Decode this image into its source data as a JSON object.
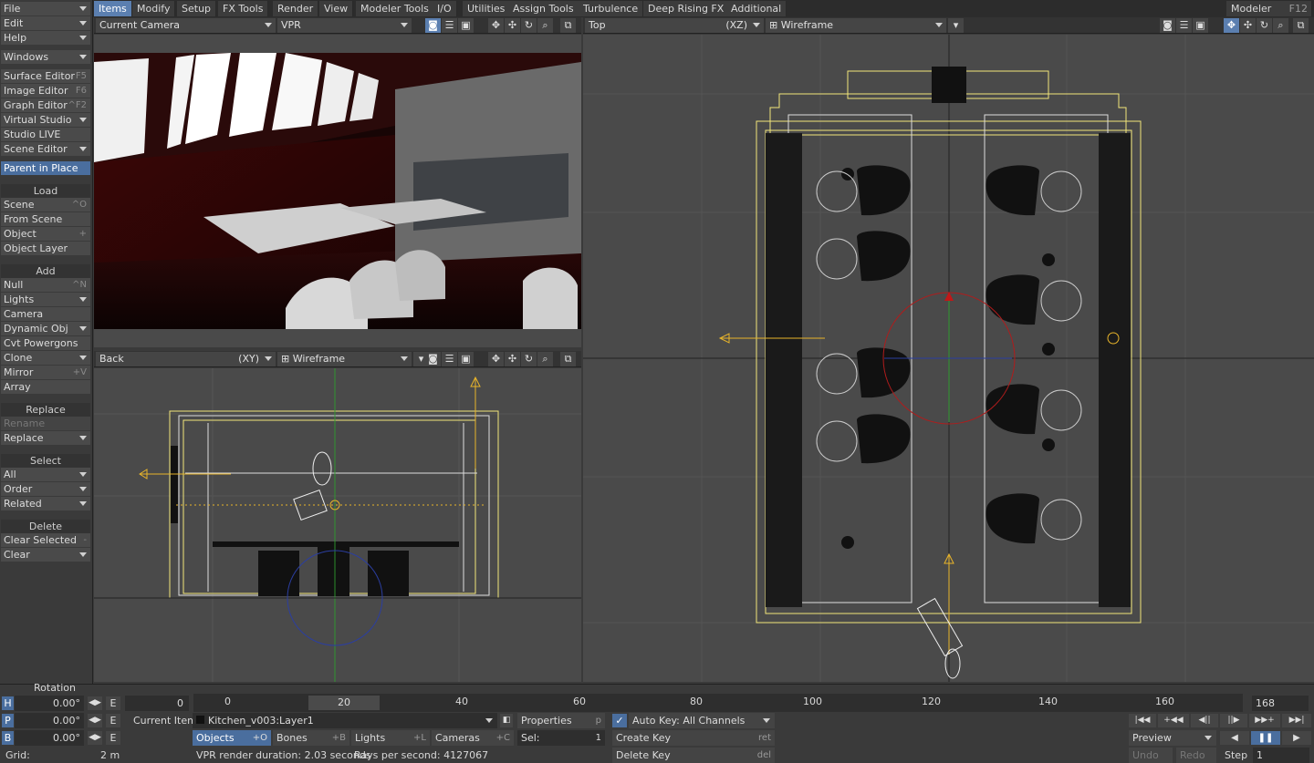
{
  "menu": {
    "file": "File",
    "edit": "Edit",
    "help": "Help",
    "windows": "Windows",
    "surface_editor": "Surface Editor",
    "surface_editor_key": "F5",
    "image_editor": "Image Editor",
    "image_editor_key": "F6",
    "graph_editor": "Graph Editor",
    "graph_editor_key": "^F2",
    "virtual_studio": "Virtual Studio",
    "studio_live": "Studio LIVE",
    "scene_editor": "Scene Editor",
    "parent_in_place": "Parent in Place"
  },
  "load": {
    "header": "Load",
    "scene": "Scene",
    "scene_key": "^O",
    "from_scene": "From Scene",
    "object": "Object",
    "object_key": "+",
    "object_layer": "Object Layer"
  },
  "add": {
    "header": "Add",
    "null": "Null",
    "null_key": "^N",
    "lights": "Lights",
    "camera": "Camera",
    "dynamic_obj": "Dynamic Obj",
    "cvt_powergons": "Cvt Powergons",
    "clone": "Clone",
    "mirror": "Mirror",
    "mirror_key": "+V",
    "array": "Array"
  },
  "replace": {
    "header": "Replace",
    "rename": "Rename",
    "replace": "Replace"
  },
  "select": {
    "header": "Select",
    "all": "All",
    "order": "Order",
    "related": "Related"
  },
  "delete": {
    "header": "Delete",
    "clear_selected": "Clear Selected",
    "clear_selected_key": "-",
    "clear": "Clear"
  },
  "tabs": [
    "Items",
    "Modify",
    "Setup",
    "FX Tools",
    "Render",
    "View",
    "Modeler Tools",
    "I/O",
    "Utilities",
    "Assign Tools",
    "Turbulence",
    "Deep Rising FX",
    "Additional"
  ],
  "modeler": {
    "label": "Modeler",
    "key": "F12"
  },
  "viewports": {
    "camera": {
      "view": "Current Camera",
      "mode": "VPR"
    },
    "back": {
      "view": "Back",
      "axis": "(XY)",
      "mode": "Wireframe"
    },
    "top": {
      "view": "Top",
      "axis": "(XZ)",
      "mode": "Wireframe"
    }
  },
  "rotation": {
    "label": "Rotation",
    "h_label": "H",
    "p_label": "P",
    "b_label": "B",
    "h": "0.00°",
    "p": "0.00°",
    "b": "0.00°",
    "e": "E"
  },
  "grid": {
    "label": "Grid:",
    "value": "2 m"
  },
  "timeline": {
    "start": "0",
    "current": "20",
    "end": "168",
    "ticks": [
      "0",
      "20",
      "40",
      "60",
      "80",
      "100",
      "120",
      "140",
      "160"
    ]
  },
  "current_item": {
    "label": "Current Item",
    "value": "Kitchen_v003:Layer1",
    "properties": "Properties",
    "properties_key": "p"
  },
  "item_types": [
    {
      "label": "Objects",
      "key": "+O"
    },
    {
      "label": "Bones",
      "key": "+B"
    },
    {
      "label": "Lights",
      "key": "+L"
    },
    {
      "label": "Cameras",
      "key": "+C"
    }
  ],
  "sel": {
    "label": "Sel:",
    "value": "1"
  },
  "autokey": {
    "label": "Auto Key: All Channels"
  },
  "keys": {
    "create": "Create Key",
    "create_key": "ret",
    "delete": "Delete Key",
    "delete_key": "del"
  },
  "status": {
    "vpr": "VPR render duration: 2.03 seconds",
    "rays": "Rays per second: 4127067"
  },
  "playback": {
    "preview": "Preview",
    "undo": "Undo",
    "redo": "Redo",
    "step_label": "Step",
    "step": "1"
  }
}
